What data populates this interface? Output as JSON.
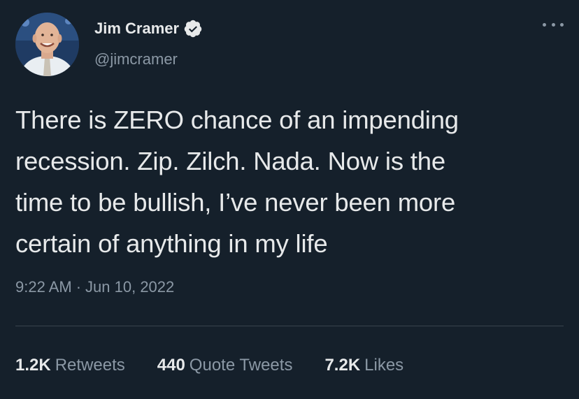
{
  "author": {
    "name": "Jim Cramer",
    "handle": "@jimcramer",
    "verified": true
  },
  "tweet": {
    "text": "There is ZERO chance of an impending\nrecession. Zip. Zilch. Nada. Now is the\ntime to be bullish, I’ve never been more\ncertain of anything in my life",
    "time": "9:22 AM",
    "separator": "·",
    "date": "Jun 10, 2022"
  },
  "stats": [
    {
      "count": "1.2K",
      "label": "Retweets"
    },
    {
      "count": "440",
      "label": "Quote Tweets"
    },
    {
      "count": "7.2K",
      "label": "Likes"
    }
  ],
  "icons": {
    "more": "more-horizontal-icon",
    "verified": "verified-badge-icon"
  },
  "colors": {
    "background": "#15202b",
    "text": "#e7e9ea",
    "secondary_text": "#8b98a5",
    "divider": "#38444d",
    "verified_badge": "#e7e9ea"
  }
}
